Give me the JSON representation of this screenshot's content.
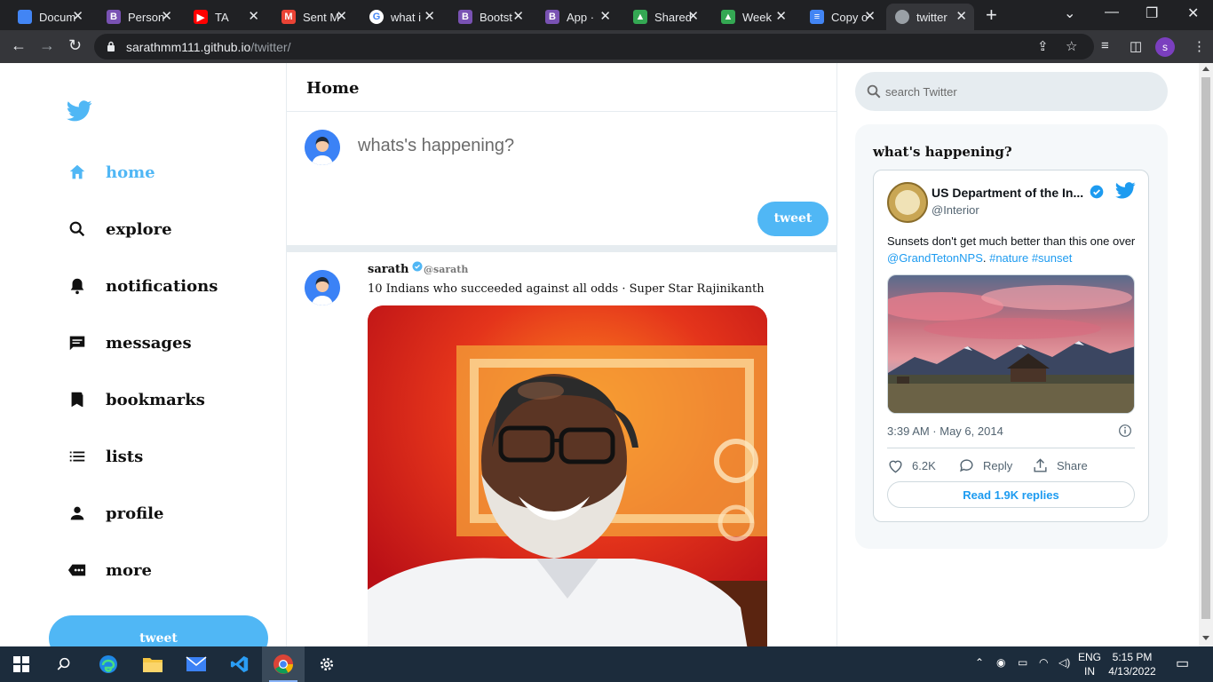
{
  "browser": {
    "tabs": [
      {
        "title": "Docum",
        "favicon": "docs-icon",
        "color": "#4285f4",
        "glyph": ""
      },
      {
        "title": "Person",
        "favicon": "bootstrap-icon",
        "color": "#7952b3",
        "glyph": "B"
      },
      {
        "title": "TA",
        "favicon": "youtube-icon",
        "color": "#ff0000",
        "glyph": "▶"
      },
      {
        "title": "Sent M",
        "favicon": "gmail-icon",
        "color": "#ea4335",
        "glyph": "M"
      },
      {
        "title": "what i",
        "favicon": "google-icon",
        "color": "#ffffff",
        "glyph": "G"
      },
      {
        "title": "Bootst",
        "favicon": "bootstrap-icon",
        "color": "#7952b3",
        "glyph": "B"
      },
      {
        "title": "App ·",
        "favicon": "bootstrap-icon",
        "color": "#7952b3",
        "glyph": "B"
      },
      {
        "title": "Shared",
        "favicon": "drive-icon",
        "color": "#34a853",
        "glyph": "▲"
      },
      {
        "title": "Week",
        "favicon": "drive-icon",
        "color": "#34a853",
        "glyph": "▲"
      },
      {
        "title": "Copy o",
        "favicon": "docs-icon",
        "color": "#4285f4",
        "glyph": "≡"
      },
      {
        "title": "twitter",
        "favicon": "globe-icon",
        "color": "#9aa0a6",
        "glyph": "",
        "active": true
      }
    ],
    "url_host": "sarathmm111.github.io",
    "url_path": "/twitter/",
    "profile_initial": "s"
  },
  "sidebar": {
    "items": [
      {
        "label": "home",
        "icon": "home-icon",
        "active": true
      },
      {
        "label": "explore",
        "icon": "search-icon"
      },
      {
        "label": "notifications",
        "icon": "bell-icon"
      },
      {
        "label": "messages",
        "icon": "message-icon"
      },
      {
        "label": "bookmarks",
        "icon": "bookmark-icon"
      },
      {
        "label": "lists",
        "icon": "list-icon"
      },
      {
        "label": "profile",
        "icon": "person-icon"
      },
      {
        "label": "more",
        "icon": "more-icon"
      }
    ],
    "tweet_label": "tweet"
  },
  "feed": {
    "header": "Home",
    "compose_placeholder": "whats's happening?",
    "compose_button": "tweet",
    "post": {
      "name": "sarath",
      "handle": "@sarath",
      "text": "10 Indians who succeeded against all odds · Super Star Rajinikanth"
    }
  },
  "widgets": {
    "search_placeholder": "search Twitter",
    "title": "what's happening?",
    "embed": {
      "account_name": "US Department of the In...",
      "account_handle": "@Interior",
      "text_plain": "Sunsets don't get much better than this one over ",
      "mention": "@GrandTetonNPS",
      "sep": ". ",
      "hashtag1": "#nature",
      "hashtag2": "#sunset",
      "date": "3:39 AM · May 6, 2014",
      "likes": "6.2K",
      "reply_label": "Reply",
      "share_label": "Share",
      "read_replies": "Read 1.9K replies"
    }
  },
  "taskbar": {
    "lang_top": "ENG",
    "lang_bottom": "IN",
    "time": "5:15 PM",
    "date": "4/13/2022"
  },
  "colors": {
    "twitter_blue": "#50b7f5",
    "link_blue": "#1d9bf0"
  }
}
